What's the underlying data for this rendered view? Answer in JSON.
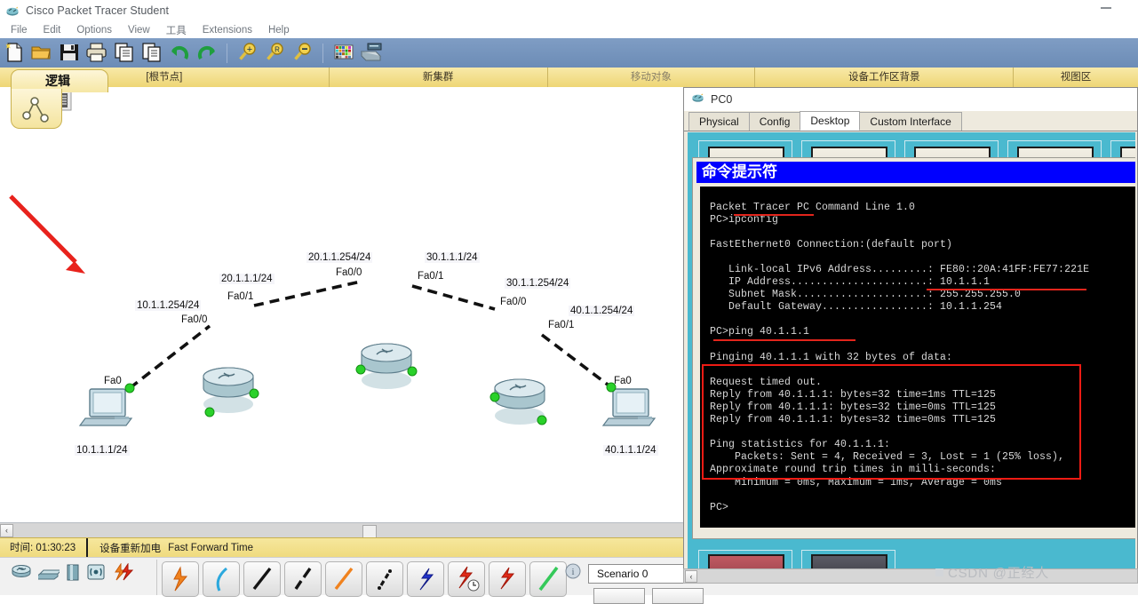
{
  "window": {
    "title": "Cisco Packet Tracer Student",
    "app_icon": "packet-tracer-icon",
    "minimize": "minimize-icon"
  },
  "menu": {
    "items": [
      "File",
      "Edit",
      "Options",
      "View",
      "工具",
      "Extensions",
      "Help"
    ]
  },
  "toolbar": {
    "buttons": [
      {
        "name": "new-file-icon",
        "label": "New"
      },
      {
        "name": "open-folder-icon",
        "label": "Open"
      },
      {
        "name": "save-icon",
        "label": "Save"
      },
      {
        "name": "print-icon",
        "label": "Print"
      },
      {
        "name": "copy-icon",
        "label": "Copy"
      },
      {
        "name": "paste-icon",
        "label": "Paste"
      },
      {
        "name": "undo-icon",
        "label": "Undo"
      },
      {
        "name": "redo-icon",
        "label": "Redo"
      },
      {
        "name": "zoom-in-icon",
        "label": "Zoom In"
      },
      {
        "name": "zoom-reset-icon",
        "label": "Zoom Reset"
      },
      {
        "name": "zoom-out-icon",
        "label": "Zoom Out"
      },
      {
        "name": "palette-icon",
        "label": "Palette"
      },
      {
        "name": "custom-device-icon",
        "label": "Custom Devices"
      }
    ]
  },
  "tabstrip": {
    "logical_tab": "逻辑",
    "logical_icon": "topology-icon",
    "segments": [
      {
        "label": "[根节点]",
        "dim": false
      },
      {
        "label": "新集群",
        "dim": false
      },
      {
        "label": "移动对象",
        "dim": true
      },
      {
        "label": "设备工作区背景",
        "dim": false
      },
      {
        "label": "视图区",
        "dim": false
      }
    ]
  },
  "topology": {
    "devices": [
      {
        "name": "pc-left",
        "type": "pc",
        "label": "10.1.1.1/24",
        "port": "Fa0"
      },
      {
        "name": "router-1",
        "type": "router",
        "left_label": "10.1.1.254/24",
        "right_label": "20.1.1.1/24",
        "left_port": "Fa0/0",
        "right_port": "Fa0/1"
      },
      {
        "name": "router-2",
        "type": "router",
        "left_label": "20.1.1.254/24",
        "right_label": "30.1.1.1/24",
        "left_port": "Fa0/0",
        "right_port": "Fa0/1"
      },
      {
        "name": "router-3",
        "type": "router",
        "left_label": "30.1.1.254/24",
        "right_label": "40.1.1.254/24",
        "left_port": "Fa0/0",
        "right_port": "Fa0/1"
      },
      {
        "name": "pc-right",
        "type": "pc",
        "label": "40.1.1.1/24",
        "port": "Fa0"
      }
    ],
    "annotation_arrow_color": "#e8221c"
  },
  "workspace_scroll": {
    "left_arrow": "‹"
  },
  "statusbar": {
    "time_label": "时间: 01:30:23",
    "message": "设备重新加电",
    "message2": "Fast Forward Time"
  },
  "bottombar": {
    "device_icons": [
      {
        "name": "routers-icon"
      },
      {
        "name": "switches-icon"
      },
      {
        "name": "hubs-icon"
      },
      {
        "name": "wireless-icon"
      },
      {
        "name": "connections-icon"
      }
    ],
    "link_tiles": [
      {
        "name": "automatic-link-icon"
      },
      {
        "name": "console-link-icon"
      },
      {
        "name": "copper-straight-link-icon"
      },
      {
        "name": "copper-crossover-link-icon"
      },
      {
        "name": "fiber-link-icon"
      },
      {
        "name": "phone-link-icon"
      },
      {
        "name": "coaxial-link-icon"
      },
      {
        "name": "serial-dce-link-icon"
      },
      {
        "name": "serial-dte-link-icon"
      },
      {
        "name": "octal-link-icon"
      }
    ],
    "scenario": {
      "info_icon": "info-icon",
      "value": "Scenario 0"
    }
  },
  "pc_window": {
    "title": "PC0",
    "icon": "pc-device-icon",
    "tabs": [
      {
        "label": "Physical",
        "active": false
      },
      {
        "label": "Config",
        "active": false
      },
      {
        "label": "Desktop",
        "active": true
      },
      {
        "label": "Custom Interface",
        "active": false
      }
    ],
    "command_prompt": {
      "title": "命令提示符",
      "lines": "Packet Tracer PC Command Line 1.0\nPC>ipconfig\n\nFastEthernet0 Connection:(default port)\n\n   Link-local IPv6 Address.........: FE80::20A:41FF:FE77:221E\n   IP Address......................: 10.1.1.1\n   Subnet Mask.....................: 255.255.255.0\n   Default Gateway.................: 10.1.1.254\n\nPC>ping 40.1.1.1\n\nPinging 40.1.1.1 with 32 bytes of data:\n\nRequest timed out.\nReply from 40.1.1.1: bytes=32 time=1ms TTL=125\nReply from 40.1.1.1: bytes=32 time=0ms TTL=125\nReply from 40.1.1.1: bytes=32 time=0ms TTL=125\n\nPing statistics for 40.1.1.1:\n    Packets: Sent = 4, Received = 3, Lost = 1 (25% loss),\nApproximate round trip times in milli-seconds:\n    Minimum = 0ms, Maximum = 1ms, Average = 0ms\n\nPC>"
    },
    "hscroll_arrow": "‹"
  },
  "watermark": "CSDN @正经人"
}
